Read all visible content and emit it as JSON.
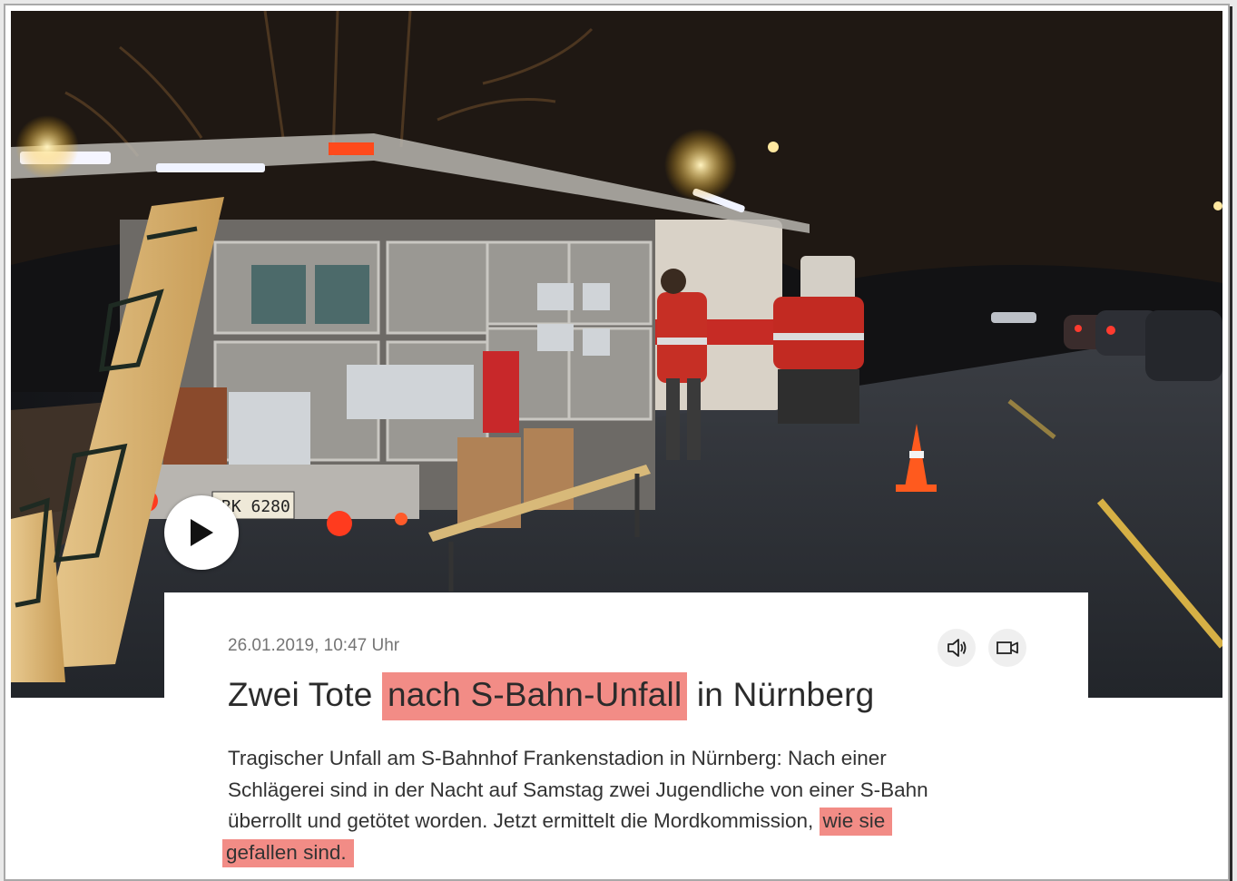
{
  "article": {
    "date": "26.01.2019, 10:47 Uhr",
    "headline_pre": "Zwei Tote ",
    "headline_highlight": "nach S-Bahn-Unfall",
    "headline_post": " in Nürnberg",
    "teaser_text": "Tragischer Unfall am S-Bahnhof Frankenstadion in Nürnberg: Nach einer Schlägerei sind in der Nacht auf Samstag zwei Jugendliche von einer S-Bahn überrollt und getötet worden. Jetzt ermittelt die Mordkommission, ",
    "teaser_highlight_1": "wie sie",
    "teaser_highlight_2": "gefallen sind."
  },
  "hero": {
    "license_plate": "RK 6280"
  },
  "icons": {
    "play": "play-icon",
    "audio": "speaker-icon",
    "video": "video-camera-icon"
  },
  "colors": {
    "highlight": "#f28c86",
    "text": "#333333",
    "date": "#757575"
  }
}
